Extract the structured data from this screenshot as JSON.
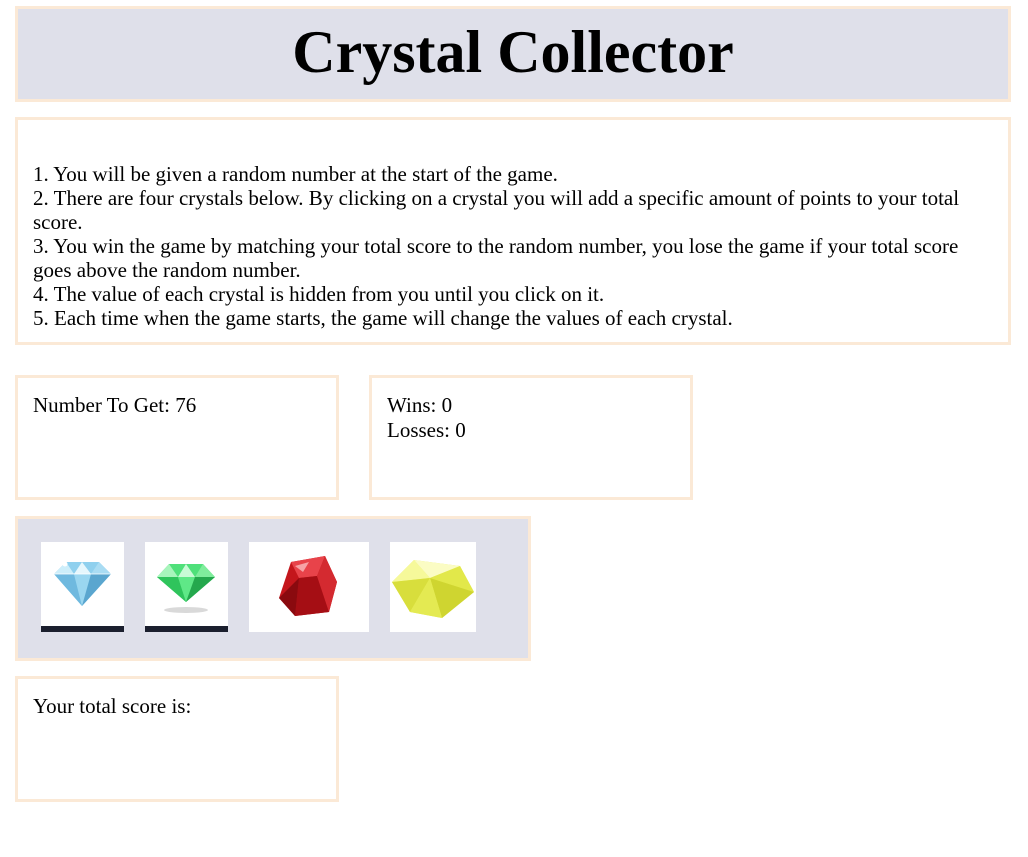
{
  "title": "Crystal Collector",
  "rules": [
    "1. You will be given a random number at the start of the game.",
    "2. There are four crystals below. By clicking on a crystal you will add a specific amount of points to your total score.",
    "3. You win the game by matching your total score to the random number, you lose the game if your total score goes above the random number.",
    "4. The value of each crystal is hidden from you until you click on it.",
    "5. Each time when the game starts, the game will change the values of each crystal."
  ],
  "target": {
    "label": "Number To Get: ",
    "value": "76"
  },
  "record": {
    "wins_label": "Wins: ",
    "wins": "0",
    "losses_label": "Losses: ",
    "losses": "0"
  },
  "crystals": [
    {
      "icon": "blue-diamond-icon",
      "color": "#8fd0ee"
    },
    {
      "icon": "green-emerald-icon",
      "color": "#4fe07a"
    },
    {
      "icon": "red-ruby-icon",
      "color": "#c4161c"
    },
    {
      "icon": "yellow-gem-icon",
      "color": "#eaf05a"
    }
  ],
  "score": {
    "label": "Your total score is:",
    "value": ""
  },
  "colors": {
    "panel_bg": "#dfe0ea",
    "border": "#fbe9d6"
  }
}
